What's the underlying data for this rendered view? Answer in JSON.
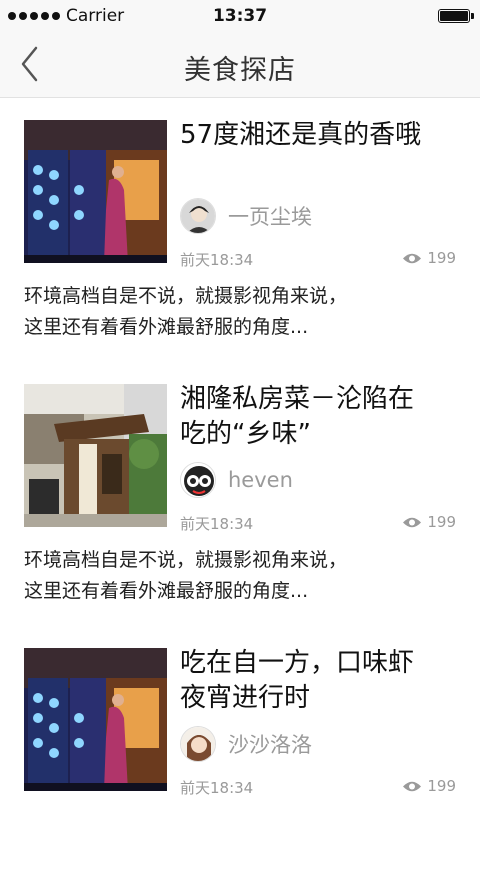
{
  "status_bar": {
    "carrier": "Carrier",
    "time": "13:37"
  },
  "nav": {
    "title": "美食探店"
  },
  "posts": [
    {
      "title": "57度湘还是真的香哦",
      "author": "一页尘埃",
      "date": "前天18:34",
      "views": "199",
      "desc_line1": "环境高档自是不说，就摄影视角来说，",
      "desc_line2": "这里还有着看外滩最舒服的角度..."
    },
    {
      "title_line1": "湘隆私房菜－沦陷在",
      "title_line2": "吃的“乡味”",
      "author": "heven",
      "date": "前天18:34",
      "views": "199",
      "desc_line1": "环境高档自是不说，就摄影视角来说，",
      "desc_line2": "这里还有着看外滩最舒服的角度..."
    },
    {
      "title_line1": "吃在自一方，口味虾",
      "title_line2": "夜宵进行时",
      "author": "沙沙洛洛",
      "date": "前天18:34",
      "views": "199"
    }
  ],
  "icons": {
    "back": "chevron-left-icon",
    "views": "eye-icon"
  }
}
